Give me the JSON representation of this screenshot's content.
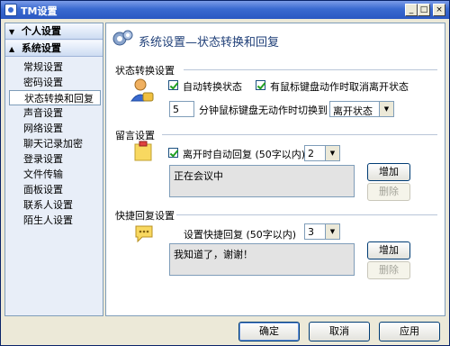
{
  "window": {
    "title": "TM设置"
  },
  "titlebar_buttons": {
    "minimize": "_",
    "maximize": "□",
    "close": "×"
  },
  "sidebar": {
    "groups": [
      {
        "label": "个人设置",
        "expanded": false
      },
      {
        "label": "系统设置",
        "expanded": true
      }
    ],
    "items": [
      {
        "label": "常规设置"
      },
      {
        "label": "密码设置"
      },
      {
        "label": "状态转换和回复",
        "selected": true
      },
      {
        "label": "声音设置"
      },
      {
        "label": "网络设置"
      },
      {
        "label": "聊天记录加密"
      },
      {
        "label": "登录设置"
      },
      {
        "label": "文件传输"
      },
      {
        "label": "面板设置"
      },
      {
        "label": "联系人设置"
      },
      {
        "label": "陌生人设置"
      }
    ]
  },
  "main": {
    "title": "系统设置—状态转换和回复",
    "status_section": {
      "label": "状态转换设置",
      "auto_switch": {
        "label": "自动转换状态",
        "checked": true
      },
      "cancel_away": {
        "label": "有鼠标键盘动作时取消离开状态",
        "checked": true
      },
      "idle_minutes": "5",
      "idle_text": "分钟鼠标键盘无动作时切换到",
      "idle_status": "离开状态"
    },
    "message_section": {
      "label": "留言设置",
      "auto_reply": {
        "label": "离开时自动回复 (50字以内)",
        "checked": true
      },
      "reply_select": "2",
      "reply_text": "正在会议中",
      "add_button": "增加",
      "delete_button": "删除"
    },
    "quick_section": {
      "label": "快捷回复设置",
      "quick_label": "设置快捷回复 (50字以内)",
      "quick_select": "3",
      "quick_text": "我知道了，谢谢！",
      "add_button": "增加",
      "delete_button": "删除"
    }
  },
  "footer": {
    "ok": "确定",
    "cancel": "取消",
    "apply": "应用"
  },
  "colors": {
    "title_blue": "#3a6ad0",
    "border": "#7f9db9",
    "accent_text": "#1f3f78"
  }
}
